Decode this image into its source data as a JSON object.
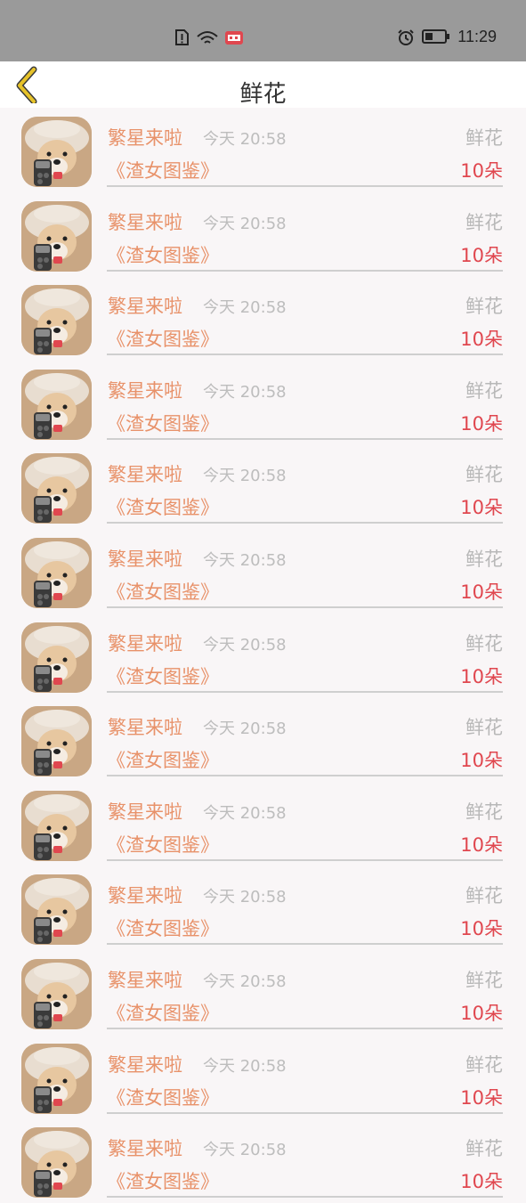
{
  "status_bar": {
    "time": "11:29"
  },
  "header": {
    "title": "鲜花"
  },
  "items": [
    {
      "name": "繁星来啦",
      "time": "今天 20:58",
      "type": "鲜花",
      "work": "《渣女图鉴》",
      "count": "10朵"
    },
    {
      "name": "繁星来啦",
      "time": "今天 20:58",
      "type": "鲜花",
      "work": "《渣女图鉴》",
      "count": "10朵"
    },
    {
      "name": "繁星来啦",
      "time": "今天 20:58",
      "type": "鲜花",
      "work": "《渣女图鉴》",
      "count": "10朵"
    },
    {
      "name": "繁星来啦",
      "time": "今天 20:58",
      "type": "鲜花",
      "work": "《渣女图鉴》",
      "count": "10朵"
    },
    {
      "name": "繁星来啦",
      "time": "今天 20:58",
      "type": "鲜花",
      "work": "《渣女图鉴》",
      "count": "10朵"
    },
    {
      "name": "繁星来啦",
      "time": "今天 20:58",
      "type": "鲜花",
      "work": "《渣女图鉴》",
      "count": "10朵"
    },
    {
      "name": "繁星来啦",
      "time": "今天 20:58",
      "type": "鲜花",
      "work": "《渣女图鉴》",
      "count": "10朵"
    },
    {
      "name": "繁星来啦",
      "time": "今天 20:58",
      "type": "鲜花",
      "work": "《渣女图鉴》",
      "count": "10朵"
    },
    {
      "name": "繁星来啦",
      "time": "今天 20:58",
      "type": "鲜花",
      "work": "《渣女图鉴》",
      "count": "10朵"
    },
    {
      "name": "繁星来啦",
      "time": "今天 20:58",
      "type": "鲜花",
      "work": "《渣女图鉴》",
      "count": "10朵"
    },
    {
      "name": "繁星来啦",
      "time": "今天 20:58",
      "type": "鲜花",
      "work": "《渣女图鉴》",
      "count": "10朵"
    },
    {
      "name": "繁星来啦",
      "time": "今天 20:58",
      "type": "鲜花",
      "work": "《渣女图鉴》",
      "count": "10朵"
    },
    {
      "name": "繁星来啦",
      "time": "今天 20:58",
      "type": "鲜花",
      "work": "《渣女图鉴》",
      "count": "10朵"
    }
  ],
  "icons": {
    "back": "chevron-left-icon",
    "avatar": "dog-avatar-image"
  },
  "colors": {
    "name": "#e8926a",
    "count": "#e0474f",
    "back_arrow": "#e6c229"
  }
}
